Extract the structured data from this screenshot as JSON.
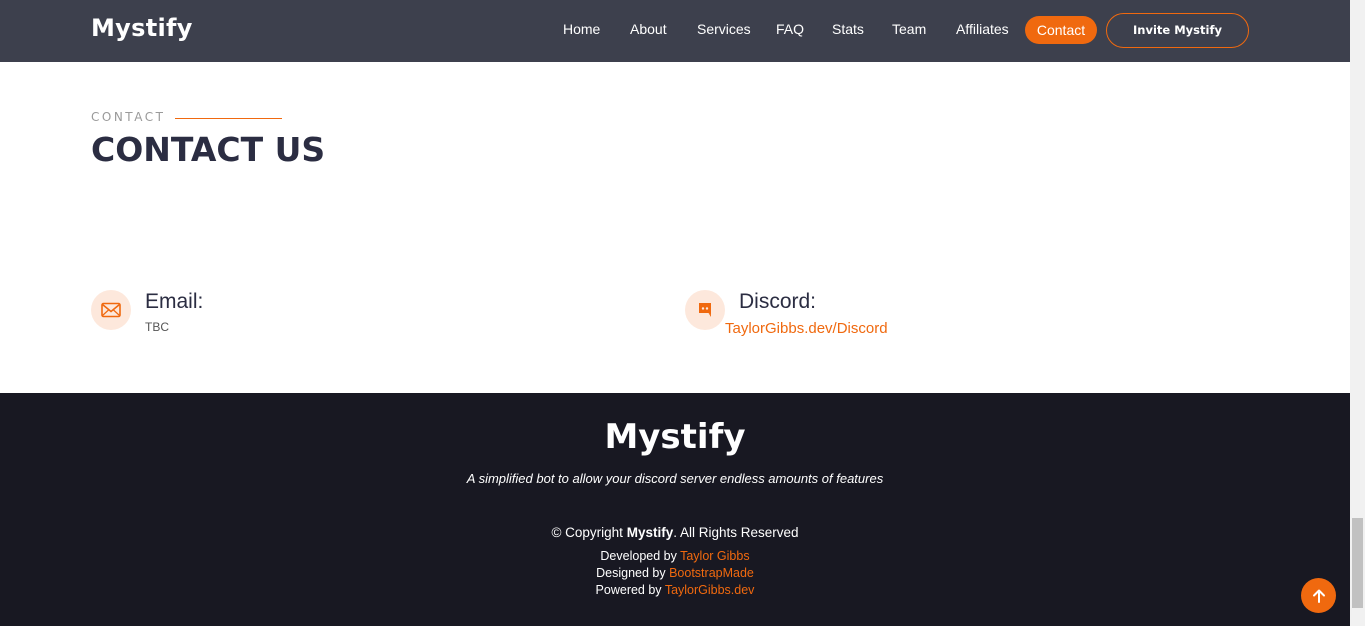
{
  "colors": {
    "header_bg": "#3d404d",
    "accent": "#f0690f",
    "footer_bg": "#181822",
    "title": "#2b2d42"
  },
  "header": {
    "logo": "Mystify",
    "nav": [
      "Home",
      "About",
      "Services",
      "FAQ",
      "Stats",
      "Team",
      "Affiliates"
    ],
    "active_nav": "Contact",
    "invite_button": "Invite Mystify"
  },
  "contact": {
    "tag": "CONTACT",
    "title": "CONTACT US",
    "email": {
      "icon": "envelope-icon",
      "label": "Email:",
      "value": "TBC"
    },
    "discord": {
      "icon": "discord-icon",
      "label": "Discord:",
      "link": "TaylorGibbs.dev/Discord"
    }
  },
  "footer": {
    "logo": "Mystify",
    "tagline": "A simplified bot to allow your discord server endless amounts of features",
    "copyright_prefix": "© Copyright",
    "copyright_brand": "Mystify",
    "copyright_suffix": ". All Rights Reserved",
    "developed_label": "Developed by",
    "developed_link": "Taylor Gibbs",
    "designed_label": "Designed by",
    "designed_link": "BootstrapMade",
    "powered_label": "Powered by",
    "powered_link": "TaylorGibbs.dev"
  },
  "back_to_top_icon": "arrow-up-icon"
}
